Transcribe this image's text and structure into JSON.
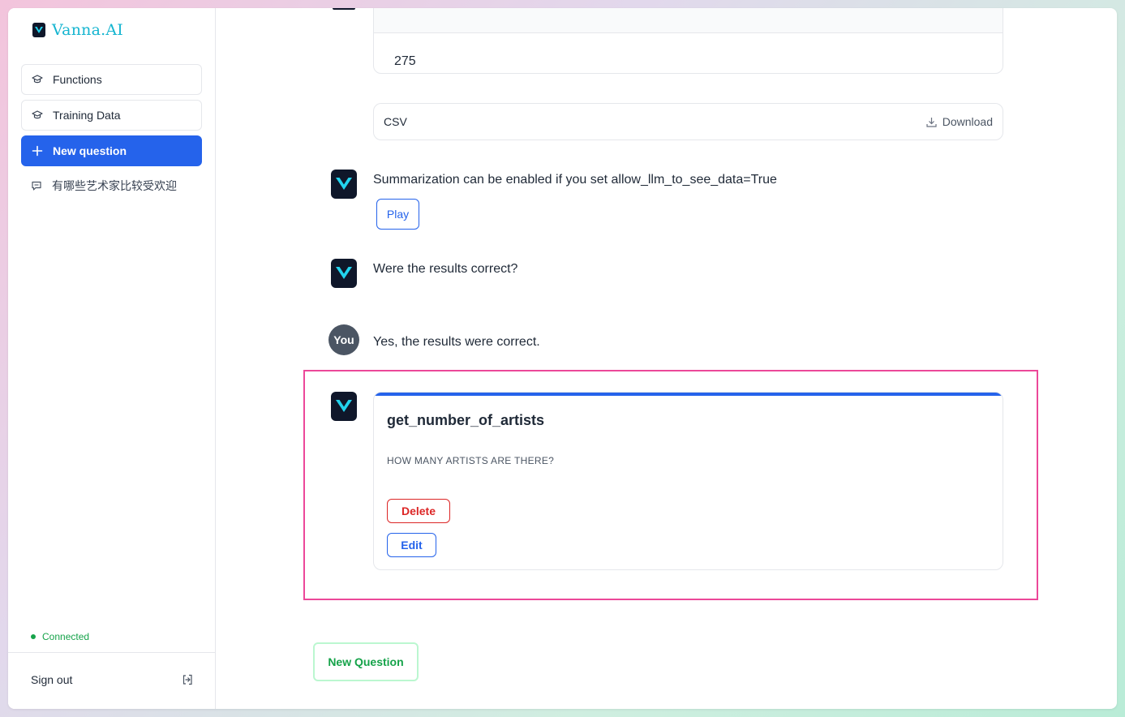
{
  "brand": {
    "name": "Vanna.AI"
  },
  "sidebar": {
    "functions_label": "Functions",
    "training_label": "Training Data",
    "new_question_label": "New question",
    "history": [
      {
        "label": "有哪些艺术家比较受欢迎"
      }
    ],
    "status_label": "Connected",
    "sign_out_label": "Sign out"
  },
  "main": {
    "result_value": "275",
    "csv_label": "CSV",
    "download_label": "Download",
    "summary_message": "Summarization can be enabled if you set allow_llm_to_see_data=True",
    "play_label": "Play",
    "question_message": "Were the results correct?",
    "you_label": "You",
    "user_reply": "Yes, the results were correct.",
    "function_card": {
      "name": "get_number_of_artists",
      "description": "HOW MANY ARTISTS ARE THERE?",
      "delete_label": "Delete",
      "edit_label": "Edit"
    },
    "new_question_button": "New Question"
  },
  "colors": {
    "primary": "#2563eb",
    "brand_cyan": "#16b5d0",
    "success": "#16a34a",
    "danger": "#dc2626",
    "highlight": "#ec4899",
    "avatar_bg": "#0f172a"
  },
  "icons": {
    "functions": "graduation-cap-icon",
    "training": "graduation-cap-icon",
    "new_question": "plus-icon",
    "history": "chat-bubble-icon",
    "sign_out": "sign-out-icon",
    "download": "download-icon"
  }
}
